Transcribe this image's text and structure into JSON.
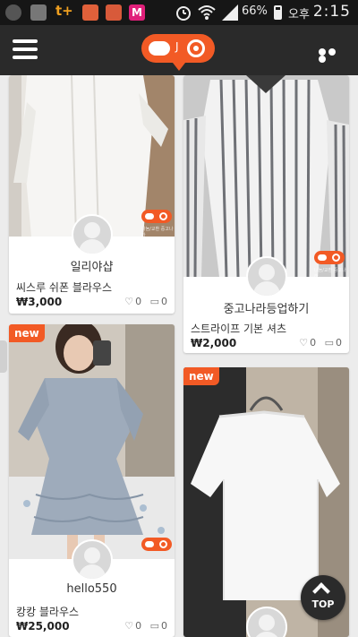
{
  "status_bar": {
    "battery": "66%",
    "time_prefix": "오후",
    "time": "2:15",
    "notification_icons": [
      "u-plus-icon",
      "gallery-icon",
      "t-plus-icon",
      "app-icon",
      "app-icon",
      "music-icon"
    ],
    "system_icons": [
      "alarm-icon",
      "wifi-icon",
      "signal-icon",
      "battery-icon"
    ],
    "t_label": "t+",
    "m_label": "M"
  },
  "header": {
    "logo_text": "J",
    "menu_icon": "hamburger-icon",
    "more_icon": "more-dots-icon"
  },
  "listings": [
    {
      "seller": "일리야샵",
      "title": "씨스루 쉬폰 블라우스",
      "price": "₩3,000",
      "likes": "0",
      "comments": "0",
      "is_new": false
    },
    {
      "seller": "중고나라등업하기",
      "title": "스트라이프 기본 셔츠",
      "price": "₩2,000",
      "likes": "0",
      "comments": "0",
      "is_new": false
    },
    {
      "seller": "hello550",
      "title": "캉캉 블라우스",
      "price": "₩25,000",
      "likes": "0",
      "comments": "0",
      "is_new": true,
      "new_label": "new"
    },
    {
      "seller": "",
      "title": "",
      "price": "",
      "likes": "",
      "comments": "",
      "is_new": true,
      "new_label": "new"
    }
  ],
  "watermark": "나눔/교환 중고나라",
  "scroll_top": {
    "label": "TOP"
  },
  "colors": {
    "accent": "#f25a25",
    "header_bg": "#2a2a2a",
    "status_bg": "#161616"
  }
}
